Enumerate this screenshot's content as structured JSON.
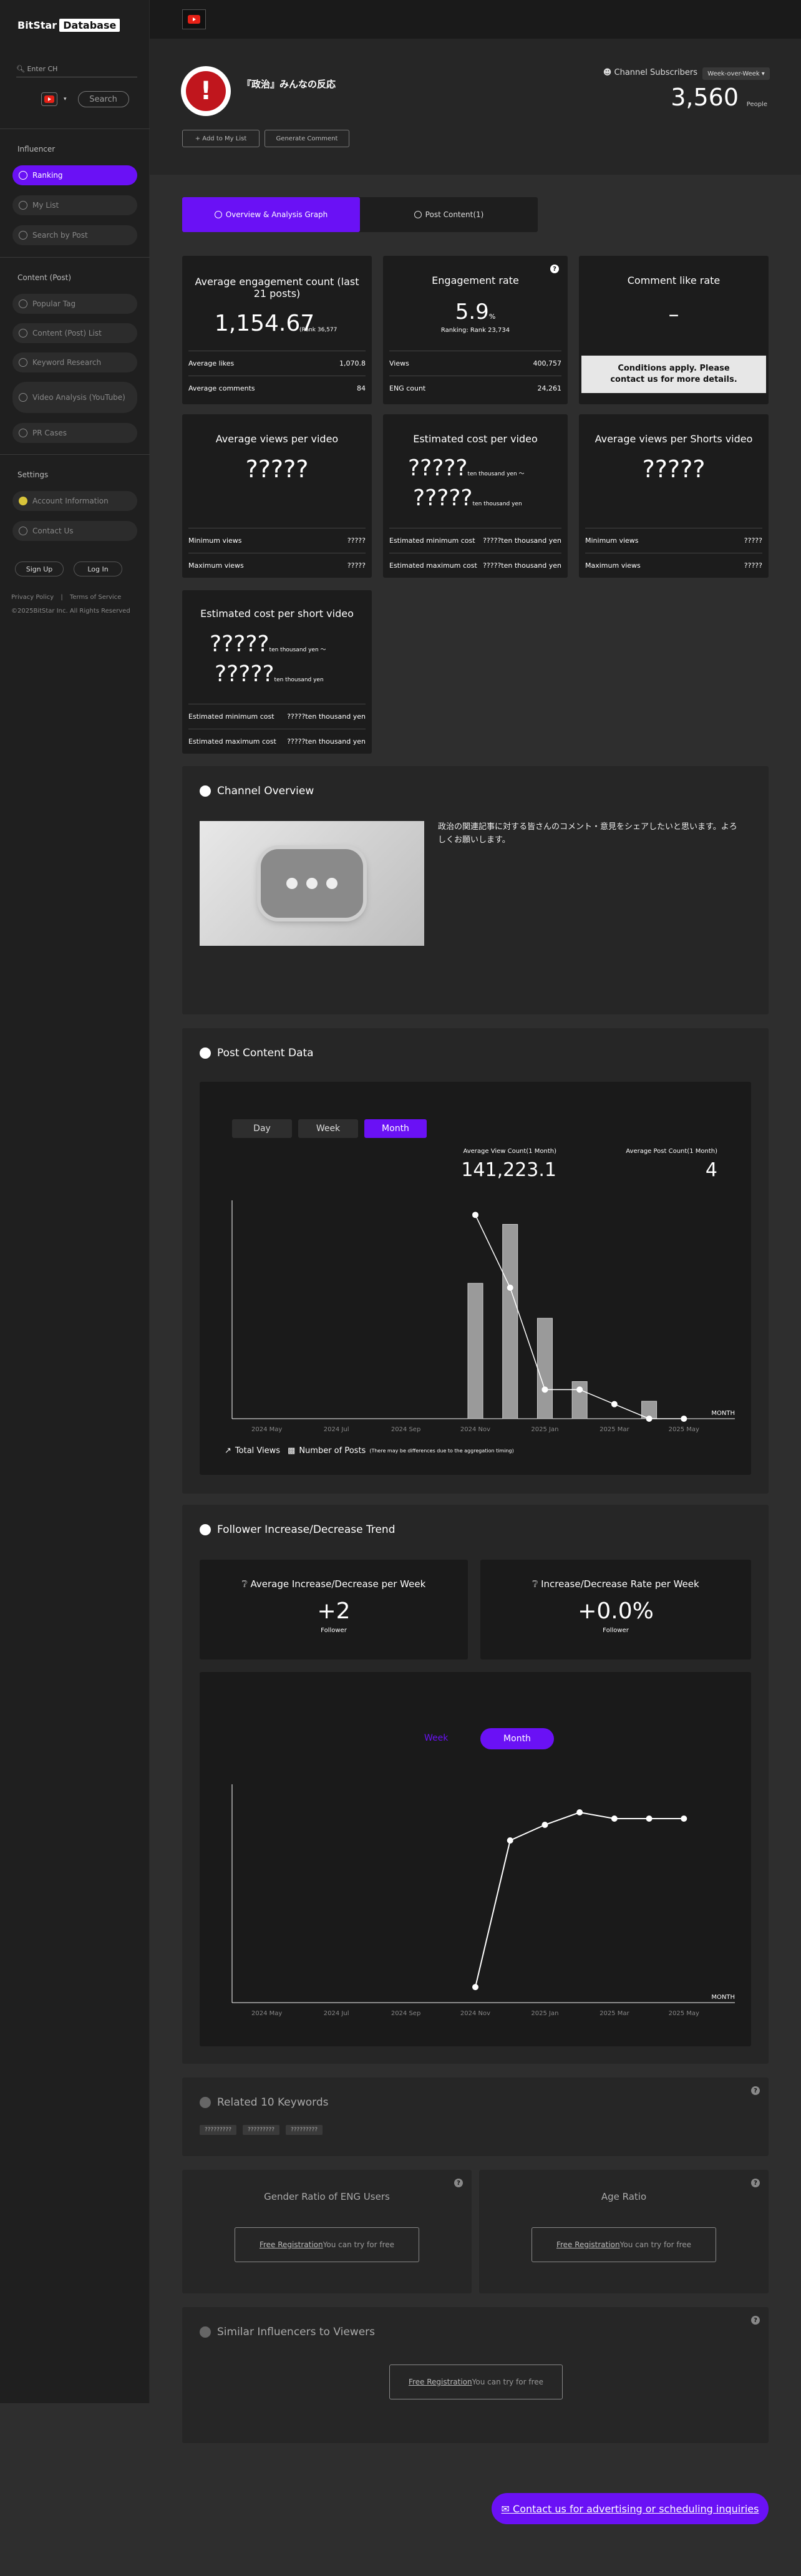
{
  "sidebar": {
    "logo_part1": "BitStar",
    "logo_part2": "Database",
    "channel_search_placeholder": "Enter CH",
    "search_label": "Search",
    "sections": {
      "influencer": "Influencer",
      "content": "Content (Post)",
      "settings": "Settings"
    },
    "items": {
      "ranking": "Ranking",
      "mylist": "My List",
      "search_by_post": "Search by Post",
      "popular_tag": "Popular Tag",
      "content_list": "Content (Post) List",
      "keyword_research": "Keyword Research",
      "video_analysis": "Video Analysis (YouTube)",
      "pr_cases": "PR Cases",
      "account": "Account Information",
      "contact": "Contact Us"
    },
    "signup": "Sign Up",
    "login": "Log In",
    "privacy": "Privacy Policy",
    "separator": "|",
    "terms": "Terms of Service",
    "copyright": "©2025BitStar Inc. All Rights Reserved"
  },
  "header": {
    "channel_name": "『政治』みんなの反応",
    "add_to_list": "+ Add to My List",
    "generate_comment": "Generate Comment",
    "subs_label": "Channel Subscribers",
    "wow": "Week-over-Week",
    "subs_value": "3,560",
    "subs_unit": "People"
  },
  "tabs": {
    "overview": "Overview & Analysis Graph",
    "post_content": "Post Content(1)"
  },
  "cards": {
    "engagement": {
      "title": "Average engagement count (last 21 posts)",
      "value": "1,154.67",
      "rank": "(Rank 36,577",
      "r1l": "Average likes",
      "r1v": "1,070.8",
      "r2l": "Average comments",
      "r2v": "84"
    },
    "rate": {
      "title": "Engagement rate",
      "value": "5.9",
      "unit": "%",
      "rank": "Ranking: Rank 23,734",
      "r1l": "Views",
      "r1v": "400,757",
      "r2l": "ENG count",
      "r2v": "24,261"
    },
    "comment_like": {
      "title": "Comment like rate",
      "value": "–",
      "notice": "Conditions apply. Please contact us for more details."
    },
    "avg_views": {
      "title": "Average views per video",
      "value": "?????",
      "r1l": "Minimum views",
      "r1v": "?????",
      "r2l": "Maximum views",
      "r2v": "?????"
    },
    "est_cost": {
      "title": "Estimated cost per video",
      "v1": "?????",
      "u1": "ten thousand yen ～",
      "v2": "?????",
      "u2": "ten thousand yen",
      "r1l": "Estimated minimum cost",
      "r1v": "?????ten thousand yen",
      "r2l": "Estimated maximum cost",
      "r2v": "?????ten thousand yen"
    },
    "avg_shorts": {
      "title": "Average views per Shorts video",
      "value": "?????",
      "r1l": "Minimum views",
      "r1v": "?????",
      "r2l": "Maximum views",
      "r2v": "?????"
    },
    "est_short": {
      "title": "Estimated cost per short video",
      "v1": "?????",
      "u1": "ten thousand yen ～",
      "v2": "?????",
      "u2": "ten thousand yen",
      "r1l": "Estimated minimum cost",
      "r1v": "?????ten thousand yen",
      "r2l": "Estimated maximum cost",
      "r2v": "?????ten thousand yen"
    }
  },
  "overview": {
    "title": "Channel Overview",
    "description": "政治の関連記事に対する皆さんのコメント・意見をシェアしたいと思います。よろしくお願いします。"
  },
  "post_data": {
    "title": "Post Content Data",
    "btn_day": "Day",
    "btn_week": "Week",
    "btn_month": "Month",
    "avg_view_label": "Average View Count(1 Month)",
    "avg_view_value": "141,223.1",
    "avg_post_label": "Average Post Count(1 Month)",
    "avg_post_value": "4",
    "legend_views": "Total Views",
    "legend_posts": "Number of Posts",
    "legend_note": "(There may be differences due to the aggregation timing)",
    "x_unit": "MONTH"
  },
  "follower": {
    "title": "Follower Increase/Decrease Trend",
    "avg_label": "Average Increase/Decrease per Week",
    "avg_value": "+2",
    "avg_unit": "Follower",
    "rate_label": "Increase/Decrease Rate per Week",
    "rate_value": "+0.0%",
    "rate_unit": "Follower",
    "btn_week": "Week",
    "btn_month": "Month",
    "x_unit": "MONTH"
  },
  "keywords": {
    "title": "Related 10 Keywords",
    "tags": [
      "?????????",
      "?????????",
      "?????????"
    ]
  },
  "gender": {
    "title": "Gender Ratio of ENG Users",
    "link": "Free Registration",
    "tail": "You can try for free"
  },
  "age": {
    "title": "Age Ratio",
    "link": "Free Registration",
    "tail": "You can try for free"
  },
  "similar": {
    "title": "Similar Influencers to Viewers",
    "link": "Free Registration",
    "tail": "You can try for free"
  },
  "contact_cta": "Contact us for advertising or scheduling inquiries",
  "chart_data": [
    {
      "type": "bar",
      "title": "Post Content Data",
      "categories": [
        "2024 May",
        "2024 Jul",
        "2024 Sep",
        "2024 Nov",
        "2025 Jan",
        "2025 Mar",
        "2025 May"
      ],
      "x_months": [
        "2024-11",
        "2024-12",
        "2025-01",
        "2025-02",
        "2025-03",
        "2025-04",
        "2025-05"
      ],
      "series": [
        {
          "name": "Total Views",
          "kind": "bar",
          "values": [
            620000,
            890000,
            460000,
            170000,
            0,
            80000,
            0
          ]
        },
        {
          "name": "Number of Posts",
          "kind": "line",
          "values": [
            14,
            9,
            2,
            2,
            1,
            0,
            0
          ]
        }
      ],
      "colors": {
        "bar": "#9a9a9a",
        "line": "#ffffff"
      }
    },
    {
      "type": "line",
      "title": "Follower Increase/Decrease Trend",
      "categories": [
        "2024 May",
        "2024 Jul",
        "2024 Sep",
        "2024 Nov",
        "2025 Jan",
        "2025 Mar",
        "2025 May"
      ],
      "x_months": [
        "2024-11",
        "2024-12",
        "2025-01",
        "2025-02",
        "2025-03",
        "2025-04",
        "2025-05"
      ],
      "series": [
        {
          "name": "Followers",
          "values": [
            2950,
            3420,
            3470,
            3510,
            3490,
            3490,
            3490
          ]
        }
      ],
      "ylim": [
        2900,
        3600
      ]
    }
  ]
}
